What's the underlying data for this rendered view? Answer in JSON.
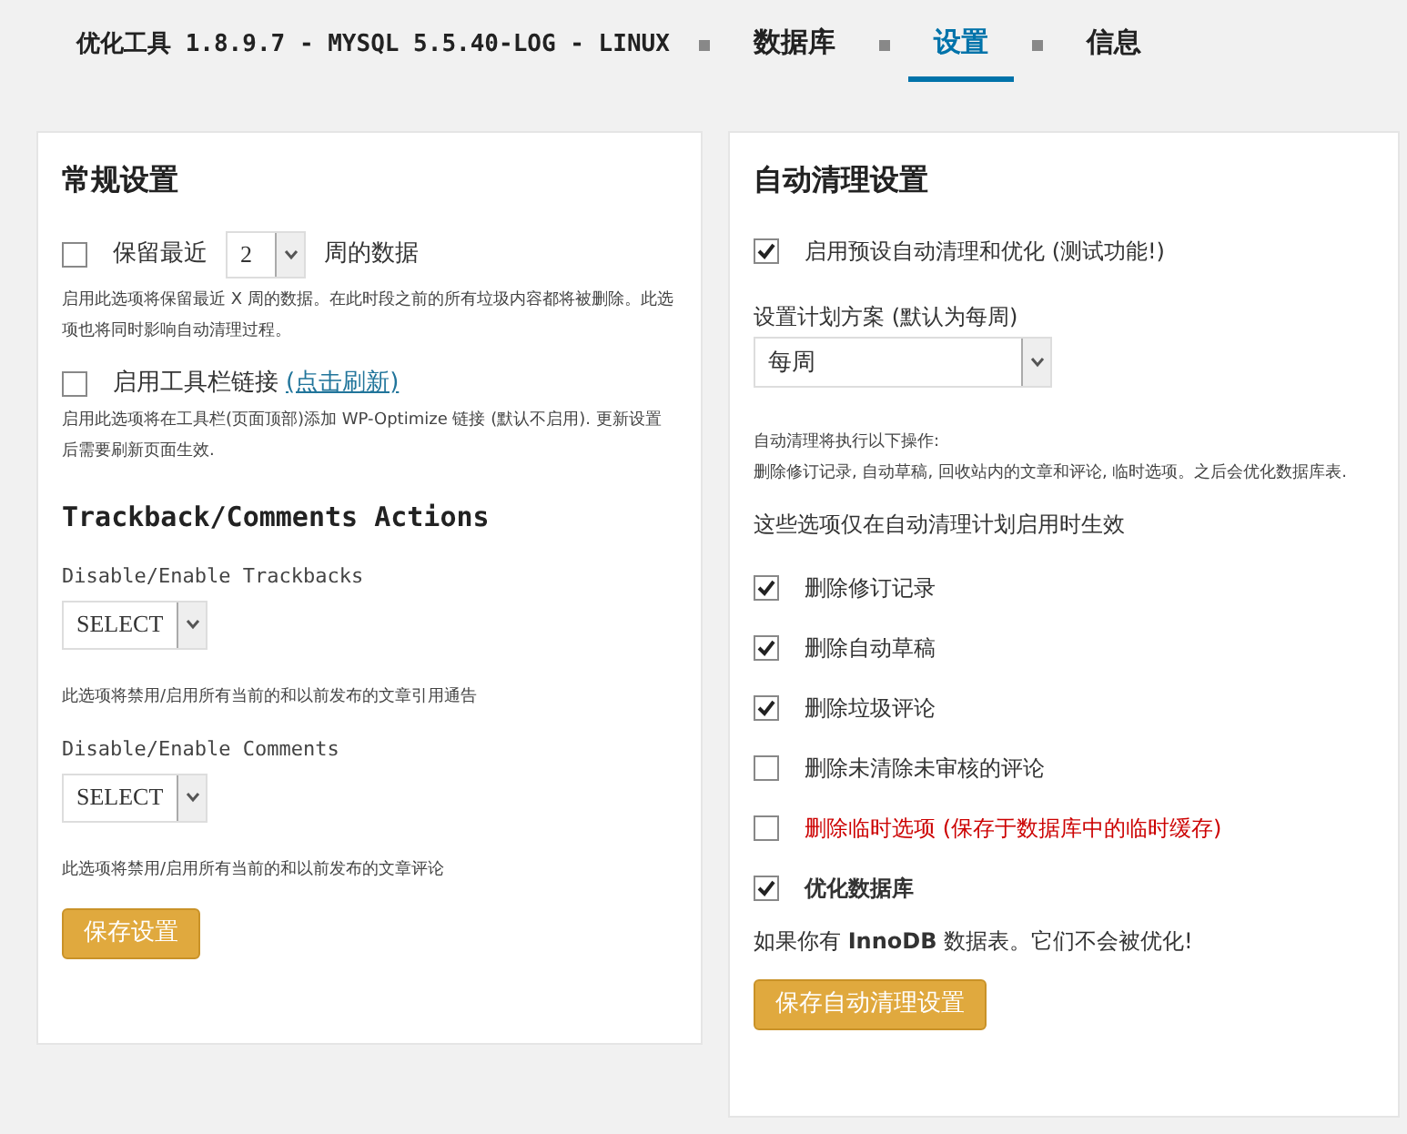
{
  "header": {
    "title": "优化工具 1.8.9.7 - MYSQL 5.5.40-LOG - LINUX",
    "tabs": [
      {
        "label": "数据库",
        "selected": false
      },
      {
        "label": "设置",
        "selected": true
      },
      {
        "label": "信息",
        "selected": false
      }
    ]
  },
  "general": {
    "title": "常规设置",
    "keep": {
      "checked": false,
      "before": "保留最近",
      "value": "2",
      "after": "周的数据",
      "note": "启用此选项将保留最近 X 周的数据。在此时段之前的所有垃圾内容都将被删除。此选项也将同时影响自动清理过程。"
    },
    "toolbar": {
      "checked": false,
      "label": "启用工具栏链接",
      "link": "(点击刷新)",
      "note": "启用此选项将在工具栏(页面顶部)添加 WP-Optimize 链接 (默认不启用). 更新设置后需要刷新页面生效."
    },
    "actions_title": "Trackback/Comments Actions",
    "actions": [
      {
        "label": "Disable/Enable Trackbacks",
        "value": "SELECT",
        "note": "此选项将禁用/启用所有当前的和以前发布的文章引用通告"
      },
      {
        "label": "Disable/Enable Comments",
        "value": "SELECT",
        "note": "此选项将禁用/启用所有当前的和以前发布的文章评论"
      }
    ],
    "save": "保存设置"
  },
  "auto": {
    "title": "自动清理设置",
    "enable": {
      "checked": true,
      "label": "启用预设自动清理和优化 (测试功能!)"
    },
    "schedule_label": "设置计划方案 (默认为每周)",
    "schedule_value": "每周",
    "info": [
      "自动清理将执行以下操作:",
      "删除修订记录, 自动草稿, 回收站内的文章和评论, 临时选项。之后会优化数据库表."
    ],
    "only_note": "这些选项仅在自动清理计划启用时生效",
    "options": [
      {
        "kind": "normal",
        "label": "删除修订记录",
        "checked": true
      },
      {
        "kind": "normal",
        "label": "删除自动草稿",
        "checked": true
      },
      {
        "kind": "normal",
        "label": "删除垃圾评论",
        "checked": true
      },
      {
        "kind": "normal",
        "label": "删除未清除未审核的评论",
        "checked": false
      },
      {
        "kind": "warning",
        "label": "删除临时选项 (保存于数据库中的临时缓存)",
        "checked": false
      },
      {
        "kind": "strong",
        "label": "优化数据库",
        "checked": true
      }
    ],
    "innodb_note": "如果你有 **InnoDB** 数据表。它们不会被优化!",
    "save": "保存自动清理设置"
  }
}
